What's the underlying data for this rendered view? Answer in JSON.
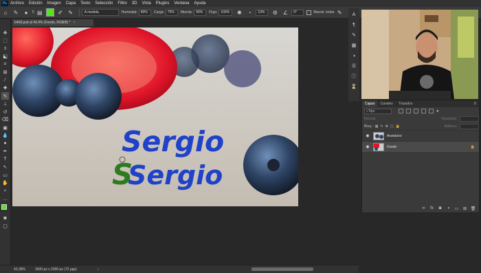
{
  "menubar": {
    "items": [
      "Archivo",
      "Edición",
      "Imagen",
      "Capa",
      "Texto",
      "Selección",
      "Filtro",
      "3D",
      "Vista",
      "Plugins",
      "Ventana",
      "Ayuda"
    ]
  },
  "options": {
    "brush_size": "5",
    "mode": "A medida",
    "hardness_label": "Humedad:",
    "hardness_value": "80%",
    "load_label": "Carga:",
    "load_value": "75%",
    "mix_label": "Mezcla:",
    "mix_value": "90%",
    "flow_label": "Flujo:",
    "flow_value": "100%",
    "smoothing_value": "10%",
    "angle_value": "0°",
    "sample_all_label": "Muestr. todas",
    "brush_color": "#55e322"
  },
  "document": {
    "tab_title": "b468.psd al 43,4% (Fondo, RGB/8) *",
    "zoom": "43,38%",
    "dimensions": "3500 px x 2000 px (72 ppp)"
  },
  "canvas": {
    "text_blue_1": "Sergio",
    "text_blue_2": "Sergio",
    "text_green_initial": "S"
  },
  "layers_panel": {
    "tabs": [
      "Capas",
      "Canales",
      "Trazados"
    ],
    "kind_label": "Tipo",
    "blend_mode": "Normal",
    "opacity_label": "Opacidad:",
    "lock_label": "Bloq.:",
    "fill_label": "Relleno:",
    "layers": [
      {
        "name": "Arandano",
        "selected": false
      },
      {
        "name": "Fondo",
        "selected": true
      }
    ]
  }
}
